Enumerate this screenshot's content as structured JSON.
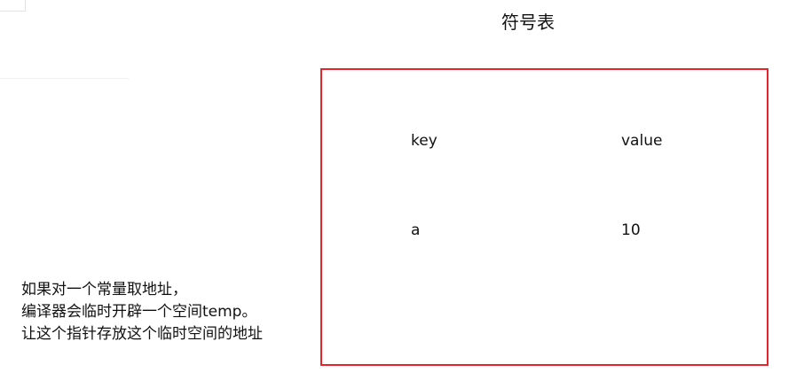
{
  "title": "符号表",
  "table": {
    "headers": {
      "key": "key",
      "value": "value"
    },
    "rows": [
      {
        "key": "a",
        "value": "10"
      }
    ],
    "border_color": "#e8242a"
  },
  "note": {
    "lines": [
      "如果对一个常量取地址，",
      "编译器会临时开辟一个空间temp。",
      "让这个指针存放这个临时空间的地址"
    ]
  }
}
